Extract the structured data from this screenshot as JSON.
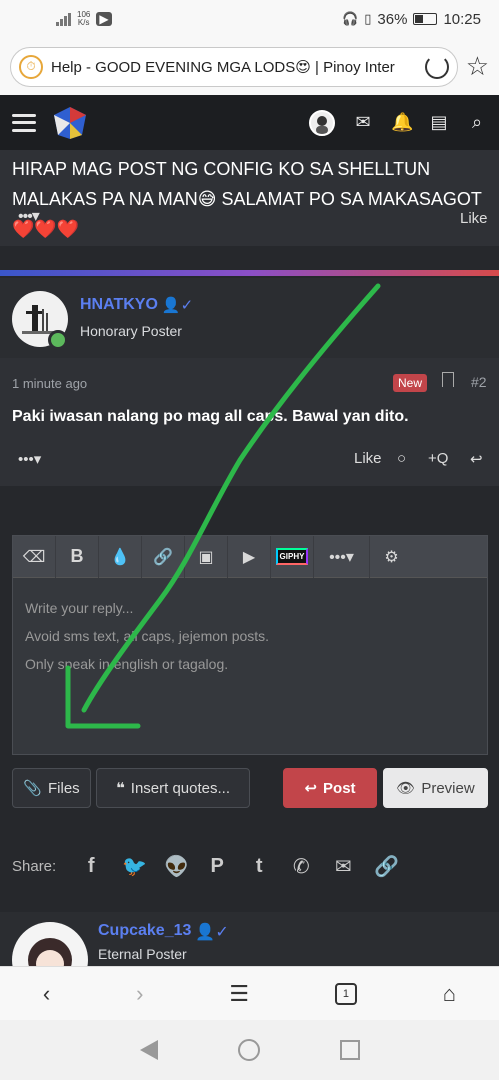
{
  "status_bar": {
    "net_speed": "106\nK/s",
    "battery": "36%",
    "time": "10:25",
    "signal_label": "4G"
  },
  "browser": {
    "url_text": "Help - GOOD EVENING MGA LODS😍 | Pinoy Inter",
    "tab_count": "1"
  },
  "site_nav": {
    "icons": [
      "menu-icon",
      "site-logo",
      "user-avatar",
      "mail-icon",
      "bell-icon",
      "document-icon",
      "search-icon"
    ]
  },
  "prev_post": {
    "text": "HIRAP MAG POST NG CONFIG KO SA SHELLTUN MALAKAS PA NA MAN😅 SALAMAT PO SA MAKASAGOT❤️❤️❤️",
    "more_label": "•••▾",
    "like_label": "Like"
  },
  "post2": {
    "username": "HNATKYO",
    "user_title": "Honorary Poster",
    "time": "1 minute ago",
    "badge": "New",
    "post_number": "#2",
    "body": "Paki iwasan nalang po mag all caps. Bawal yan dito.",
    "more_label": "•••▾",
    "actions": {
      "like": "Like",
      "quote": "+Q"
    }
  },
  "editor": {
    "toolbar_icons": [
      "eraser-icon",
      "bold-icon",
      "color-drop-icon",
      "link-icon",
      "image-icon",
      "video-icon",
      "giphy-icon",
      "more-options-icon",
      "settings-gear-icon"
    ],
    "giphy_label": "GIPHY",
    "more_label": "•••▾",
    "placeholder_lines": [
      "Write your reply...",
      "Avoid sms text, all caps, jejemon posts.",
      "Only speak in english or tagalog."
    ]
  },
  "buttons": {
    "files": "Files",
    "insert_quotes": "Insert quotes...",
    "post": "Post",
    "preview": "Preview"
  },
  "share": {
    "label": "Share:",
    "icons": [
      "facebook-icon",
      "twitter-icon",
      "reddit-icon",
      "pinterest-icon",
      "tumblr-icon",
      "whatsapp-icon",
      "email-icon",
      "link-icon"
    ]
  },
  "post3": {
    "username": "Cupcake_13",
    "user_title": "Eternal Poster"
  },
  "colors": {
    "accent_blue": "#5b7ff0",
    "post_red": "#c2454a",
    "online_green": "#5cb85c",
    "annotation_green": "#2db84a"
  }
}
